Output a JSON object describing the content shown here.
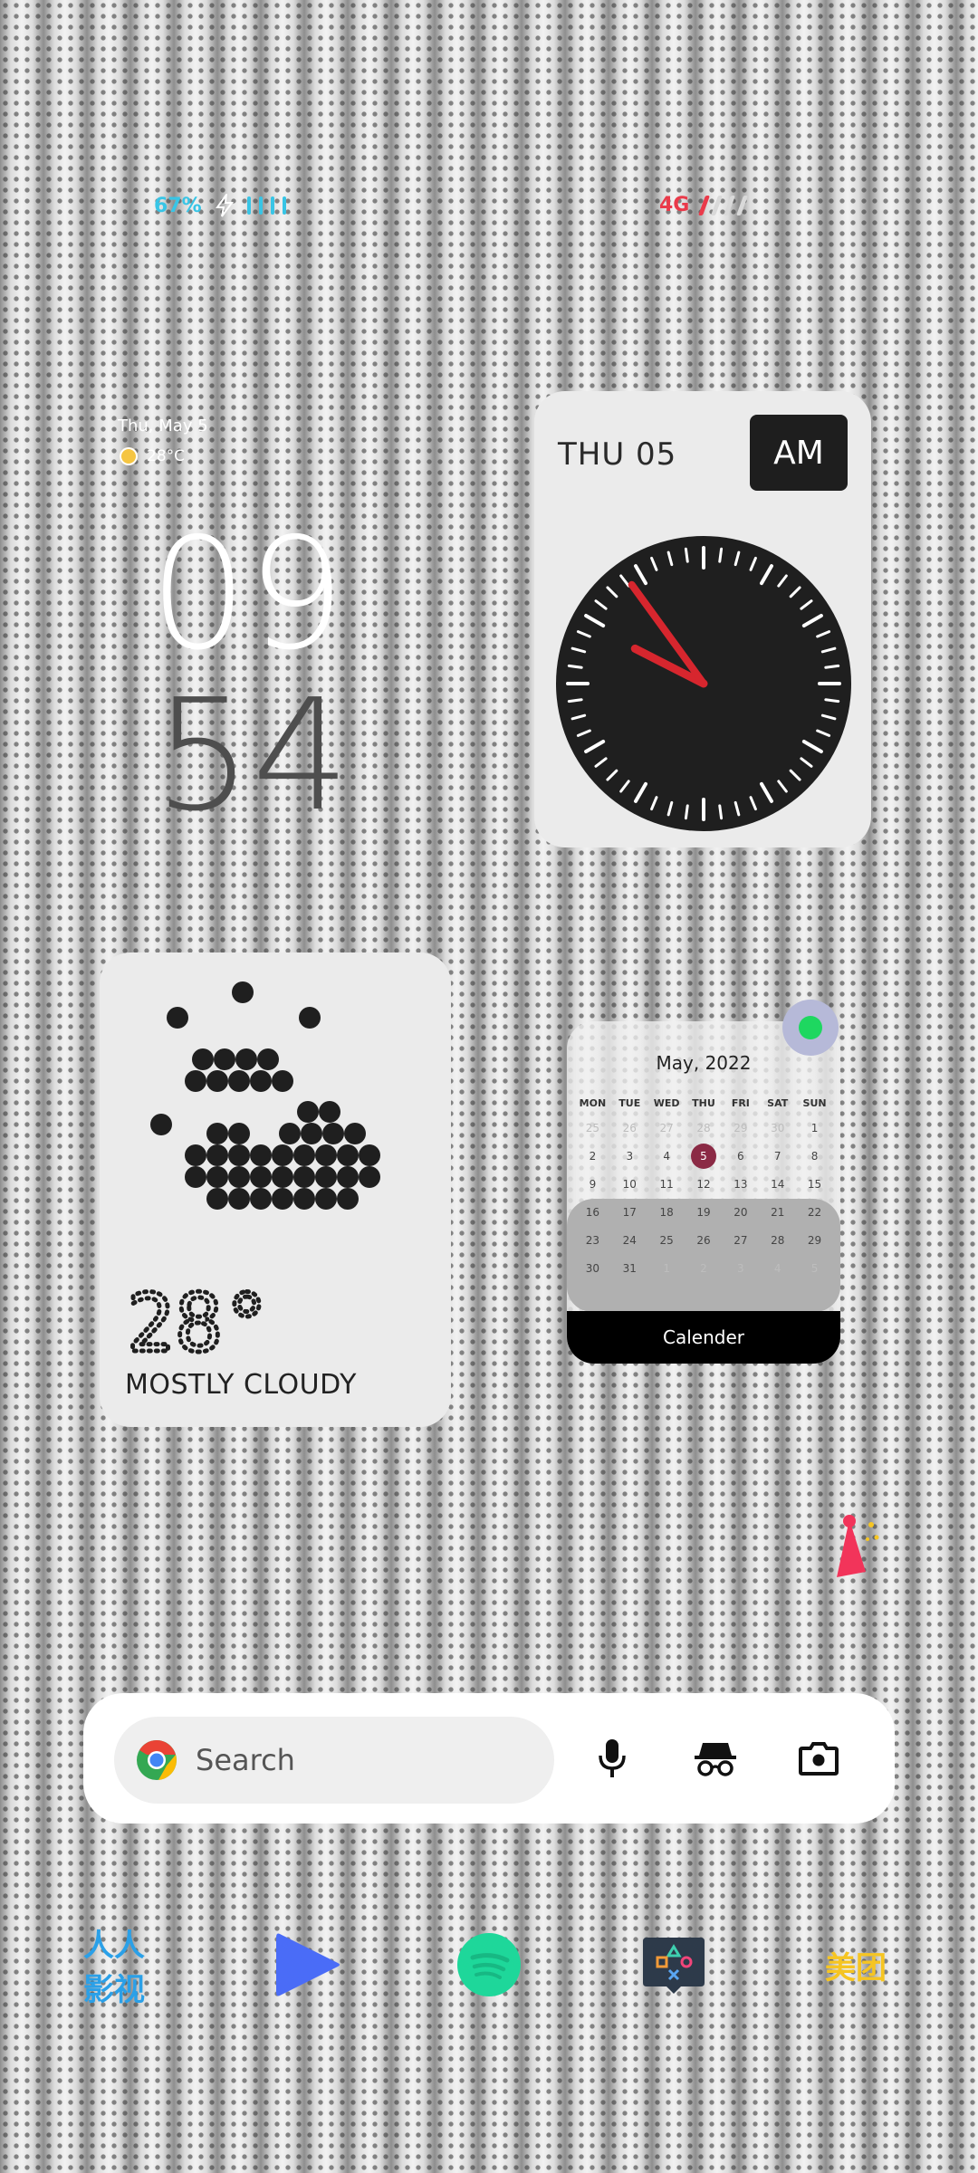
{
  "status_bar": {
    "battery": "67%",
    "network": "4G"
  },
  "home_clock": {
    "date": "Thu, May 5",
    "temperature": "28°C",
    "hour": "09",
    "minute": "54"
  },
  "analog_clock": {
    "day": "THU 05",
    "period": "AM",
    "time": "09:54"
  },
  "weather_widget": {
    "temperature": "28°",
    "condition": "MOSTLY CLOUDY"
  },
  "calendar_widget": {
    "title": "May, 2022",
    "weekdays": [
      "MON",
      "TUE",
      "WED",
      "THU",
      "FRI",
      "SAT",
      "SUN"
    ],
    "today": "5",
    "footer": "Calender"
  },
  "search_widget": {
    "placeholder": "Search"
  },
  "dock": {
    "app1_label": "人人影视",
    "app5_label": "美团"
  },
  "colors": {
    "accent_cyan": "#38c5e6",
    "accent_red": "#ea3a4a",
    "clock_hand": "#d7262e",
    "today_highlight": "#8b2a45",
    "spotify_green": "#1ed760",
    "meituan_yellow": "#f6c522"
  }
}
